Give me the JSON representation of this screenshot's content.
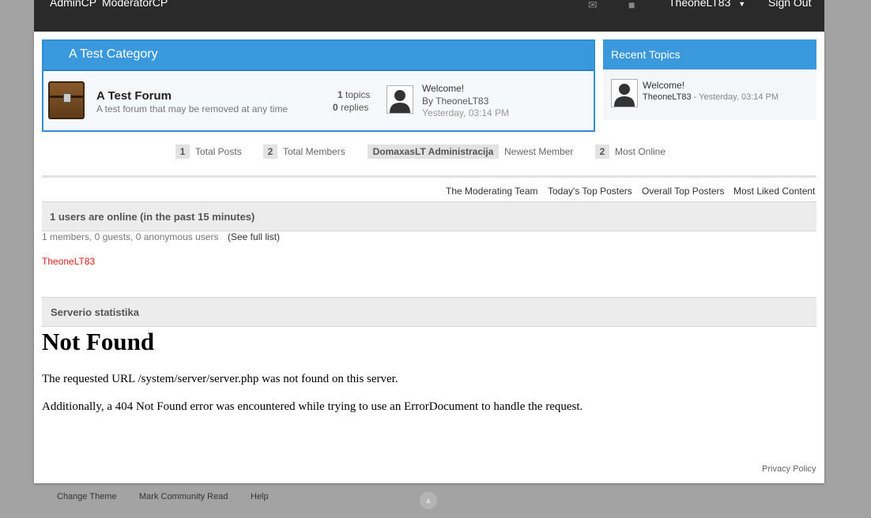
{
  "topbar": {
    "admin_cp": "AdminCP",
    "moderator_cp": "ModeratorCP",
    "username": "TheoneLT83",
    "sign_out": "Sign Out",
    "mail_icon": "mail-icon",
    "notification_icon": "notification-icon"
  },
  "category": {
    "title": "A Test Category",
    "forum": {
      "name": "A Test Forum",
      "description": "A test forum that may be removed at any time",
      "topics_count": "1",
      "topics_label": "topics",
      "replies_count": "0",
      "replies_label": "replies",
      "last_post": {
        "title": "Welcome!",
        "by": "By TheoneLT83",
        "time": "Yesterday, 03:14 PM"
      }
    }
  },
  "recent_topics": {
    "title": "Recent Topics",
    "items": [
      {
        "title": "Welcome!",
        "author": "TheoneLT83",
        "time": " - Yesterday, 03:14 PM"
      }
    ]
  },
  "stats": [
    {
      "value": "1",
      "label": "Total Posts"
    },
    {
      "value": "2",
      "label": "Total Members"
    },
    {
      "value": "DomaxasLT Administracija",
      "label": "Newest Member"
    },
    {
      "value": "2",
      "label": "Most Online"
    }
  ],
  "links": [
    "The Moderating Team",
    "Today's Top Posters",
    "Overall Top Posters",
    "Most Liked Content"
  ],
  "online": {
    "title": "1 users are online (in the past 15 minutes)",
    "summary": "1 members, 0 guests, 0 anonymous users",
    "see_full": "(See full list)",
    "users": [
      "TheoneLT83"
    ]
  },
  "server": {
    "title": "Serverio statistika",
    "error_heading": "Not Found",
    "error_line1": "The requested URL /system/server/server.php was not found on this server.",
    "error_line2": "Additionally, a 404 Not Found error was encountered while trying to use an ErrorDocument to handle the request."
  },
  "privacy_policy": "Privacy Policy",
  "footer": {
    "change_theme": "Change Theme",
    "mark_read": "Mark Community Read",
    "help": "Help",
    "scroll_up_icon": "arrow-up-icon"
  },
  "colors": {
    "accent": "#3a99dd",
    "online_user": "#e02020"
  }
}
